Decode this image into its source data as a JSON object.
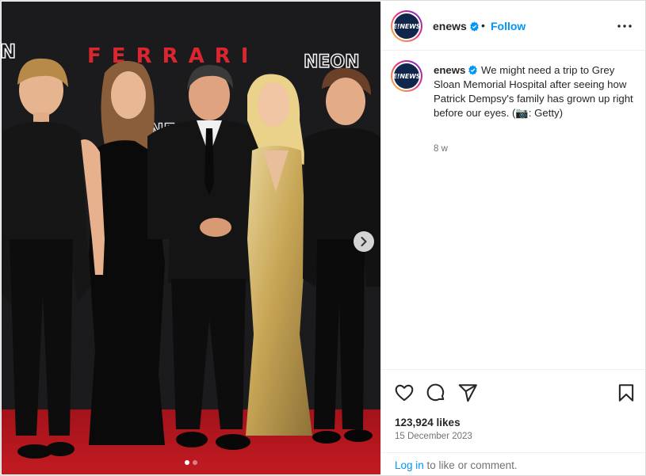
{
  "post": {
    "username": "enews",
    "avatar_text": "E!NEWS",
    "follow_label": "Follow",
    "separator": "•",
    "more_icon": "more-horizontal-icon",
    "verified_icon": "verified-badge-icon"
  },
  "caption": {
    "username": "enews",
    "text": "We might need a trip to Grey Sloan Memorial Hospital after seeing how Patrick Dempsy's family has grown up right before our eyes. (📷: Getty)",
    "time_ago": "8 w"
  },
  "media": {
    "backdrop_words": [
      "FERRARI",
      "NEON",
      "N",
      "NEON"
    ],
    "next_icon": "chevron-right-icon",
    "carousel": {
      "count": 2,
      "active_index": 0
    }
  },
  "actions": {
    "icons": [
      "heart-icon",
      "comment-icon",
      "share-icon",
      "save-icon"
    ],
    "likes": "123,924 likes",
    "date": "15 December 2023"
  },
  "login": {
    "link_label": "Log in",
    "rest": " to like or comment."
  },
  "colors": {
    "link_blue": "#0095f6",
    "text": "#262626",
    "muted": "#737373",
    "divider": "#efefef",
    "carpet": "#b5161e",
    "backdrop": "#1c1c1f",
    "ferrari_red": "#d9262f",
    "gold_dress": "#c8a656"
  }
}
